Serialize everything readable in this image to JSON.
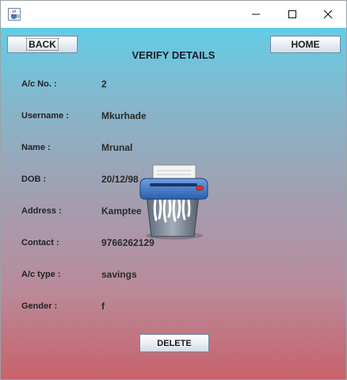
{
  "window": {
    "title": "",
    "controls": {
      "minimize": "minimize-icon",
      "maximize": "maximize-icon",
      "close": "close-icon"
    }
  },
  "toolbar": {
    "back_label": "BACK",
    "home_label": "HOME"
  },
  "page": {
    "title": "VERIFY DETAILS"
  },
  "fields": [
    {
      "label": "A/c No. :",
      "value": "2"
    },
    {
      "label": "Username :",
      "value": "Mkurhade"
    },
    {
      "label": "Name :",
      "value": "Mrunal"
    },
    {
      "label": "DOB :",
      "value": "20/12/98"
    },
    {
      "label": "Address :",
      "value": "Kamptee"
    },
    {
      "label": "Contact :",
      "value": "9766262129"
    },
    {
      "label": "A/c type :",
      "value": "savings"
    },
    {
      "label": "Gender :",
      "value": "f"
    }
  ],
  "actions": {
    "delete_label": "DELETE"
  },
  "icons": {
    "app": "java-cup-icon",
    "illustration": "shredder-icon"
  },
  "colors": {
    "gradient_top": "#63cde6",
    "gradient_bottom": "#c8626b",
    "button_border": "#6f8aa6"
  }
}
